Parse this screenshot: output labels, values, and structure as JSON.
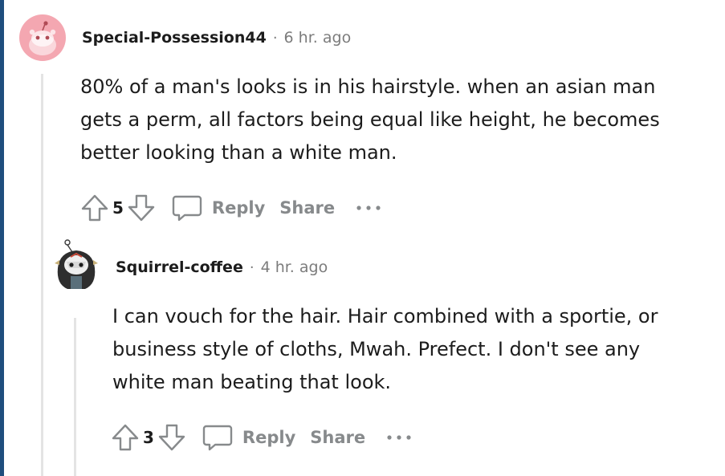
{
  "comments": [
    {
      "author": "Special-Possession44",
      "separator": "·",
      "time": "6 hr. ago",
      "body": "80% of a man's looks is in his hairstyle. when an asian man gets a perm, all factors being equal like height, he becomes better looking than a white man.",
      "score": "5",
      "reply_label": "Reply",
      "share_label": "Share",
      "avatar_icon": "snoo-avatar-icon",
      "avatar_color": "#f4a7b1"
    },
    {
      "author": "Squirrel-coffee",
      "separator": "·",
      "time": "4 hr. ago",
      "body": "I can vouch for the hair. Hair combined with a sportie, or business style of cloths, Mwah. Prefect. I don't see any white man beating that look.",
      "score": "3",
      "reply_label": "Reply",
      "share_label": "Share",
      "avatar_icon": "snoo-avatar-icon"
    }
  ],
  "colors": {
    "meta_gray": "#7c7c7c",
    "action_gray": "#878a8c",
    "thread_line": "#e4e4e4",
    "left_edge": "#1f4e7d"
  }
}
